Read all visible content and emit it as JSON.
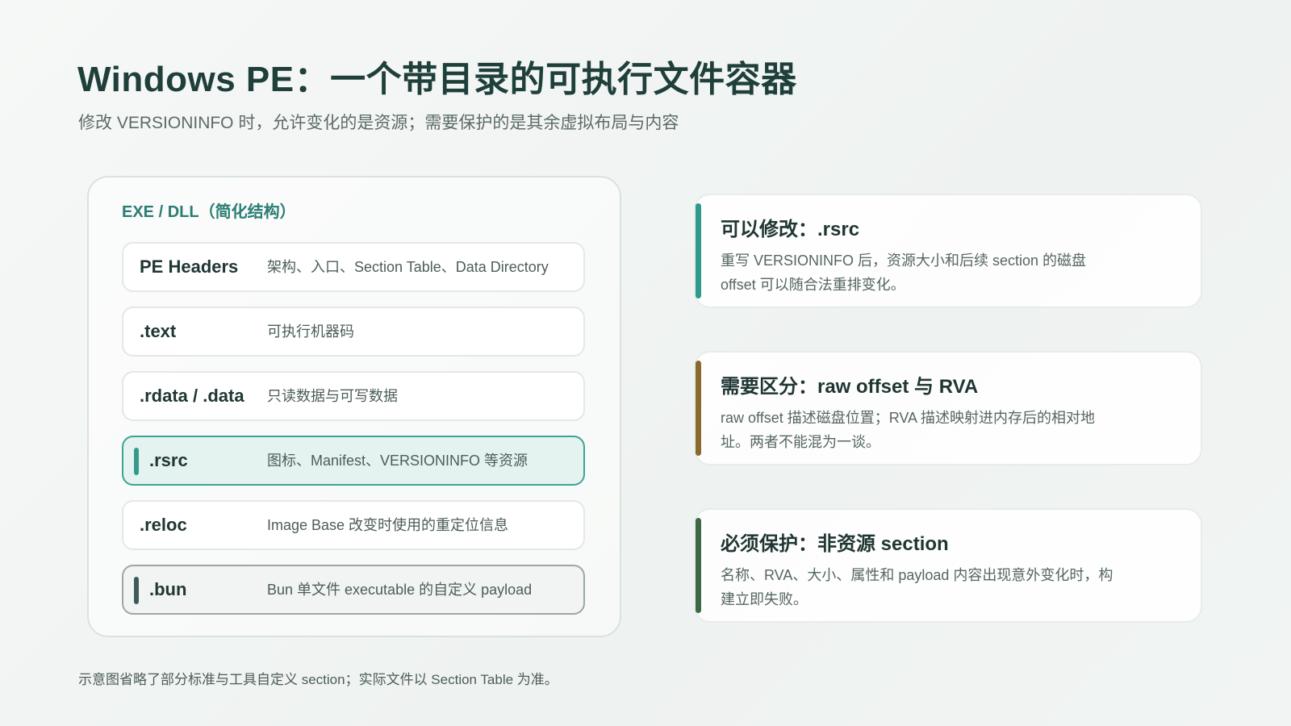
{
  "header": {
    "title": "Windows PE：一个带目录的可执行文件容器",
    "subtitle": "修改 VERSIONINFO 时，允许变化的是资源；需要保护的是其余虚拟布局与内容"
  },
  "diagram": {
    "title": "EXE / DLL（简化结构）",
    "sections": [
      {
        "name": "PE Headers",
        "desc": "架构、入口、Section Table、Data Directory"
      },
      {
        "name": ".text",
        "desc": "可执行机器码"
      },
      {
        "name": ".rdata / .data",
        "desc": "只读数据与可写数据"
      },
      {
        "name": ".rsrc",
        "desc": "图标、Manifest、VERSIONINFO 等资源"
      },
      {
        "name": ".reloc",
        "desc": "Image Base 改变时使用的重定位信息"
      },
      {
        "name": ".bun",
        "desc": "Bun 单文件 executable 的自定义 payload"
      }
    ]
  },
  "cards": [
    {
      "title": "可以修改：.rsrc",
      "body": "重写 VERSIONINFO 后，资源大小和后续 section 的磁盘 offset 可以随合法重排变化。",
      "accent": "#2f9a8b"
    },
    {
      "title": "需要区分：raw offset 与 RVA",
      "body": "raw offset 描述磁盘位置；RVA 描述映射进内存后的相对地址。两者不能混为一谈。",
      "accent": "#8a6a2c"
    },
    {
      "title": "必须保护：非资源 section",
      "body": "名称、RVA、大小、属性和 payload 内容出现意外变化时，构建立即失败。",
      "accent": "#3d6a45"
    }
  ],
  "footnote": "示意图省略了部分标准与工具自定义 section；实际文件以 Section Table 为准。"
}
